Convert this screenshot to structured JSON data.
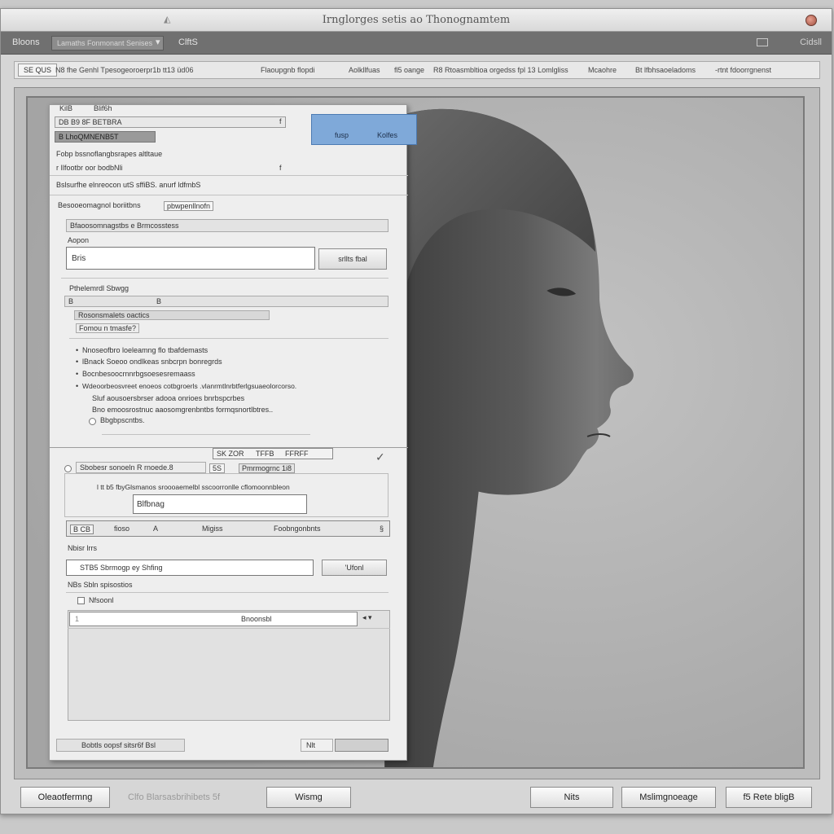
{
  "window": {
    "title": "Irnglorges setis ao Thonognamtem"
  },
  "menubar": {
    "left_item": "Bloons",
    "combo": "Lamaths Fonmonant Senises",
    "combo_arrow": "▾",
    "middle_item": "ClftS",
    "right_item": "Cidsll"
  },
  "toolbar": {
    "left_label": "SE QUS",
    "items": [
      "N8 fhe Genhl Tpesogeoroerpr1b tt13 üd06",
      "Flaoupgnb flopdi",
      "Aolkllfuas",
      "fl5 oange",
      "R8 Rtoasmbltioa orgedss fpl 13 Lomlgliss",
      "Mcaohre",
      "Bt lfbhsaoeladoms",
      "-rtnt fdoorrgnenst"
    ]
  },
  "panel": {
    "header_tabs": [
      "KilB",
      "Blif6h"
    ],
    "field_a": "DB B9 8F BETBRA",
    "field_a_suffix": "f",
    "field_b": "B LhoQMNENB5T",
    "blue_box": {
      "left": "fusp",
      "right": "Kolfes"
    },
    "line_1": "Fobp bssnoflangbsrapes altltaue",
    "line_2": "r Ilfootbr oor bodbNli",
    "line_2_suffix": "f",
    "line_3": "Bslsurfhe elnreocon utS sffiBS.   anurf ldfmbS",
    "section_1": "Besooeomagnol boriitbns",
    "section_1_chip": "pbwpenllnofn",
    "list_header": "Bfaoosomnagstbs e Brmcosstess",
    "input_label": "Aopon",
    "input_value": "Bris",
    "input_button": "srllts fbal",
    "section_2": "Pthelemrdl Sbwgg",
    "subbox_a": "B",
    "subbox_a_suffix": "B",
    "subbox_label": "Rosonsmalets oactics",
    "subbox_chip": "Fomou n tmasfe?",
    "bullets": [
      "Nnoseofbro loeleamng flo tbafdemasts",
      "lBnack Soeoo ondlkeas snbcrpn bonregrds",
      "Bocnbesoocrnnrbgsoesesremaass",
      "Wdeoorbeosvreet enoeos cotbgroerls   .vlanrmtlnrbtferlgsuaeolorcorso.",
      "Sluf aousoersbrser adooa onrioes bnrbspcrbes",
      "Bno emoosrostnuc aaosomgrenbntbs formqsnortlbtres..",
      "Bbgbpscntbs."
    ],
    "toggle_row": [
      "SK ZOR",
      "TFFB",
      "FFRFF"
    ],
    "radio_label": "Sbobesr sonoeln R rnoede.8",
    "radio_chip_a": "5S",
    "radio_chip_b": "Pmrmogrnc 1i8",
    "checkmark": "✓",
    "sub_label": "l tt b5  fbyGlsmanos sroooaemelbl  sscoorronlle cflomoonnbleon",
    "sub_input": "Blfbnag",
    "tool_row": {
      "a": "B CB",
      "b": "fioso",
      "c": "A",
      "d": "Migiss",
      "e": "Foobngonbnts",
      "f": "§"
    },
    "label_nome": "Nbisr lrrs",
    "field_c": "STB5   Sbrmogp ey   Shfing",
    "field_c_button": "'Ufonl",
    "label_size": "NBs Sbln spisostios",
    "check_label": "Nfsoonl",
    "search_value": "Bnoonsbl",
    "search_left": "1",
    "search_arrows": "◂ ▾",
    "footer_left": "Bobtls oopsf sitsr6f Bsl",
    "footer_right": "Nlt"
  },
  "footer": {
    "btn_1": "Oleaotfermng",
    "muted": "Clfo Blarsasbrihibets 5f",
    "btn_2": "Wismg",
    "btn_3": "Nits",
    "btn_4": "Mslimgnoeage",
    "btn_5": "f5  Rete bligB"
  }
}
